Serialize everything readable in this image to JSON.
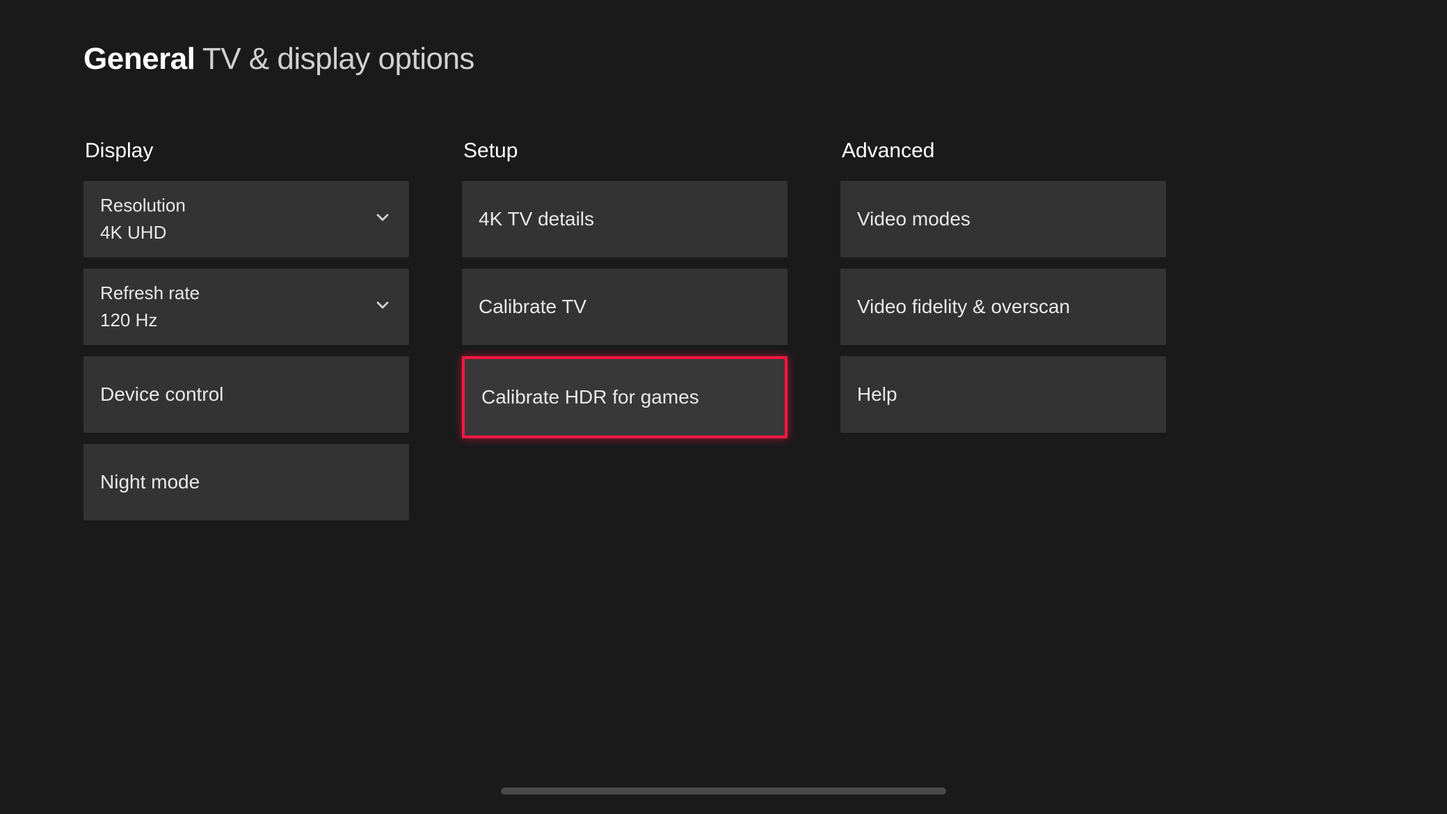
{
  "header": {
    "bold": "General",
    "light": "TV & display options"
  },
  "columns": {
    "display": {
      "title": "Display",
      "resolution": {
        "label": "Resolution",
        "value": "4K UHD"
      },
      "refreshRate": {
        "label": "Refresh rate",
        "value": "120 Hz"
      },
      "deviceControl": {
        "label": "Device control"
      },
      "nightMode": {
        "label": "Night mode"
      }
    },
    "setup": {
      "title": "Setup",
      "fourKDetails": {
        "label": "4K TV details"
      },
      "calibrateTV": {
        "label": "Calibrate TV"
      },
      "calibrateHDR": {
        "label": "Calibrate HDR for games"
      }
    },
    "advanced": {
      "title": "Advanced",
      "videoModes": {
        "label": "Video modes"
      },
      "videoFidelity": {
        "label": "Video fidelity & overscan"
      },
      "help": {
        "label": "Help"
      }
    }
  }
}
